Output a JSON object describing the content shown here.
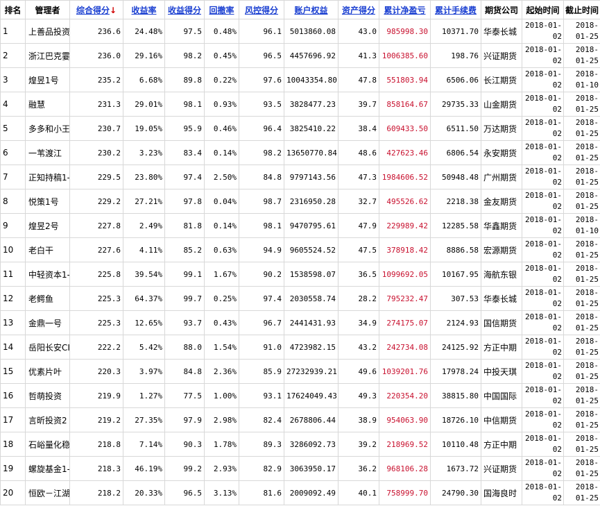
{
  "headers": {
    "rank": "排名",
    "manager": "管理者",
    "composite_score": "综合得分",
    "sort_arrow": "↓",
    "return_rate": "收益率",
    "return_score": "收益得分",
    "drawdown": "回撤率",
    "risk_score": "风控得分",
    "equity": "账户权益",
    "asset_score": "资产得分",
    "net_pnl": "累计净盈亏",
    "fees": "累计手续费",
    "futures_company": "期货公司",
    "start_time": "起始时间",
    "end_time": "截止时间"
  },
  "colors": {
    "link": "#1a3fd1",
    "sort_arrow": "#d00000",
    "pnl": "#c8102e"
  },
  "rows": [
    {
      "rank": "1",
      "manager": "上善品投资",
      "score": "236.6",
      "ret": "24.48%",
      "ret_score": "97.5",
      "dd": "0.48%",
      "risk": "96.1",
      "equity": "5013860.08",
      "asset": "43.0",
      "pnl": "985998.30",
      "fee": "10371.70",
      "company": "华泰长城",
      "start": "2018-01-02",
      "end": "2018-01-25"
    },
    {
      "rank": "2",
      "manager": "浙江巴克霎",
      "score": "236.0",
      "ret": "29.16%",
      "ret_score": "98.2",
      "dd": "0.45%",
      "risk": "96.5",
      "equity": "4457696.92",
      "asset": "41.3",
      "pnl": "1006385.60",
      "fee": "198.76",
      "company": "兴证期货",
      "start": "2018-01-02",
      "end": "2018-01-25"
    },
    {
      "rank": "3",
      "manager": "煌昱1号",
      "score": "235.2",
      "ret": "6.68%",
      "ret_score": "89.8",
      "dd": "0.22%",
      "risk": "97.6",
      "equity": "10043354.80",
      "asset": "47.8",
      "pnl": "551803.94",
      "fee": "6506.06",
      "company": "长江期货",
      "start": "2018-01-02",
      "end": "2018-01-10"
    },
    {
      "rank": "4",
      "manager": "融慧",
      "score": "231.3",
      "ret": "29.01%",
      "ret_score": "98.1",
      "dd": "0.93%",
      "risk": "93.5",
      "equity": "3828477.23",
      "asset": "39.7",
      "pnl": "858164.67",
      "fee": "29735.33",
      "company": "山金期货",
      "start": "2018-01-02",
      "end": "2018-01-25"
    },
    {
      "rank": "5",
      "manager": "多多和小王",
      "score": "230.7",
      "ret": "19.05%",
      "ret_score": "95.9",
      "dd": "0.46%",
      "risk": "96.4",
      "equity": "3825410.22",
      "asset": "38.4",
      "pnl": "609433.50",
      "fee": "6511.50",
      "company": "万达期货",
      "start": "2018-01-02",
      "end": "2018-01-25"
    },
    {
      "rank": "6",
      "manager": "一苇渡江",
      "score": "230.2",
      "ret": "3.23%",
      "ret_score": "83.4",
      "dd": "0.14%",
      "risk": "98.2",
      "equity": "13650770.84",
      "asset": "48.6",
      "pnl": "427623.46",
      "fee": "6806.54",
      "company": "永安期货",
      "start": "2018-01-02",
      "end": "2018-01-25"
    },
    {
      "rank": "7",
      "manager": "正知持稿1-",
      "score": "229.5",
      "ret": "23.80%",
      "ret_score": "97.4",
      "dd": "2.50%",
      "risk": "84.8",
      "equity": "9797143.56",
      "asset": "47.3",
      "pnl": "1984606.52",
      "fee": "50948.48",
      "company": "广州期货",
      "start": "2018-01-02",
      "end": "2018-01-25"
    },
    {
      "rank": "8",
      "manager": "悦策1号",
      "score": "229.2",
      "ret": "27.21%",
      "ret_score": "97.8",
      "dd": "0.04%",
      "risk": "98.7",
      "equity": "2316950.28",
      "asset": "32.7",
      "pnl": "495526.62",
      "fee": "2218.38",
      "company": "金友期货",
      "start": "2018-01-02",
      "end": "2018-01-25"
    },
    {
      "rank": "9",
      "manager": "煌昱2号",
      "score": "227.8",
      "ret": "2.49%",
      "ret_score": "81.8",
      "dd": "0.14%",
      "risk": "98.1",
      "equity": "9470795.61",
      "asset": "47.9",
      "pnl": "229989.42",
      "fee": "12285.58",
      "company": "华鑫期货",
      "start": "2018-01-02",
      "end": "2018-01-10"
    },
    {
      "rank": "10",
      "manager": "老白干",
      "score": "227.6",
      "ret": "4.11%",
      "ret_score": "85.2",
      "dd": "0.63%",
      "risk": "94.9",
      "equity": "9605524.52",
      "asset": "47.5",
      "pnl": "378918.42",
      "fee": "8886.58",
      "company": "宏源期货",
      "start": "2018-01-02",
      "end": "2018-01-25"
    },
    {
      "rank": "11",
      "manager": "中轻资本1-",
      "score": "225.8",
      "ret": "39.54%",
      "ret_score": "99.1",
      "dd": "1.67%",
      "risk": "90.2",
      "equity": "1538598.07",
      "asset": "36.5",
      "pnl": "1099692.05",
      "fee": "10167.95",
      "company": "海航东银",
      "start": "2018-01-02",
      "end": "2018-01-25"
    },
    {
      "rank": "12",
      "manager": "老鳄鱼",
      "score": "225.3",
      "ret": "64.37%",
      "ret_score": "99.7",
      "dd": "0.25%",
      "risk": "97.4",
      "equity": "2030558.74",
      "asset": "28.2",
      "pnl": "795232.47",
      "fee": "307.53",
      "company": "华泰长城",
      "start": "2018-01-02",
      "end": "2018-01-25"
    },
    {
      "rank": "13",
      "manager": "金鼎一号",
      "score": "225.3",
      "ret": "12.65%",
      "ret_score": "93.7",
      "dd": "0.43%",
      "risk": "96.7",
      "equity": "2441431.93",
      "asset": "34.9",
      "pnl": "274175.07",
      "fee": "2124.93",
      "company": "国信期货",
      "start": "2018-01-02",
      "end": "2018-01-25"
    },
    {
      "rank": "14",
      "manager": "岳阳长安CI",
      "score": "222.2",
      "ret": "5.42%",
      "ret_score": "88.0",
      "dd": "1.54%",
      "risk": "91.0",
      "equity": "4723982.15",
      "asset": "43.2",
      "pnl": "242734.08",
      "fee": "24125.92",
      "company": "方正中期",
      "start": "2018-01-02",
      "end": "2018-01-25"
    },
    {
      "rank": "15",
      "manager": "优素片叶",
      "score": "220.3",
      "ret": "3.97%",
      "ret_score": "84.8",
      "dd": "2.36%",
      "risk": "85.9",
      "equity": "27232939.21",
      "asset": "49.6",
      "pnl": "1039201.76",
      "fee": "17978.24",
      "company": "中投天琪",
      "start": "2018-01-02",
      "end": "2018-01-25"
    },
    {
      "rank": "16",
      "manager": "哲萌投资",
      "score": "219.9",
      "ret": "1.27%",
      "ret_score": "77.5",
      "dd": "1.00%",
      "risk": "93.1",
      "equity": "17624049.43",
      "asset": "49.3",
      "pnl": "220354.20",
      "fee": "38815.80",
      "company": "中国国际",
      "start": "2018-01-02",
      "end": "2018-01-25"
    },
    {
      "rank": "17",
      "manager": "言昕投资2",
      "score": "219.2",
      "ret": "27.35%",
      "ret_score": "97.9",
      "dd": "2.98%",
      "risk": "82.4",
      "equity": "2678806.44",
      "asset": "38.9",
      "pnl": "954063.90",
      "fee": "18726.10",
      "company": "中信期货",
      "start": "2018-01-02",
      "end": "2018-01-25"
    },
    {
      "rank": "18",
      "manager": "石峪量化稳",
      "score": "218.8",
      "ret": "7.14%",
      "ret_score": "90.3",
      "dd": "1.78%",
      "risk": "89.3",
      "equity": "3286092.73",
      "asset": "39.2",
      "pnl": "218969.52",
      "fee": "10110.48",
      "company": "方正中期",
      "start": "2018-01-02",
      "end": "2018-01-25"
    },
    {
      "rank": "19",
      "manager": "螺旋基金1-",
      "score": "218.3",
      "ret": "46.19%",
      "ret_score": "99.2",
      "dd": "2.93%",
      "risk": "82.9",
      "equity": "3063950.17",
      "asset": "36.2",
      "pnl": "968106.28",
      "fee": "1673.72",
      "company": "兴证期货",
      "start": "2018-01-02",
      "end": "2018-01-25"
    },
    {
      "rank": "20",
      "manager": "恒欧－江湖",
      "score": "218.2",
      "ret": "20.33%",
      "ret_score": "96.5",
      "dd": "3.13%",
      "risk": "81.6",
      "equity": "2009092.49",
      "asset": "40.1",
      "pnl": "758999.70",
      "fee": "24790.30",
      "company": "国海良时",
      "start": "2018-01-02",
      "end": "2018-01-25"
    }
  ]
}
